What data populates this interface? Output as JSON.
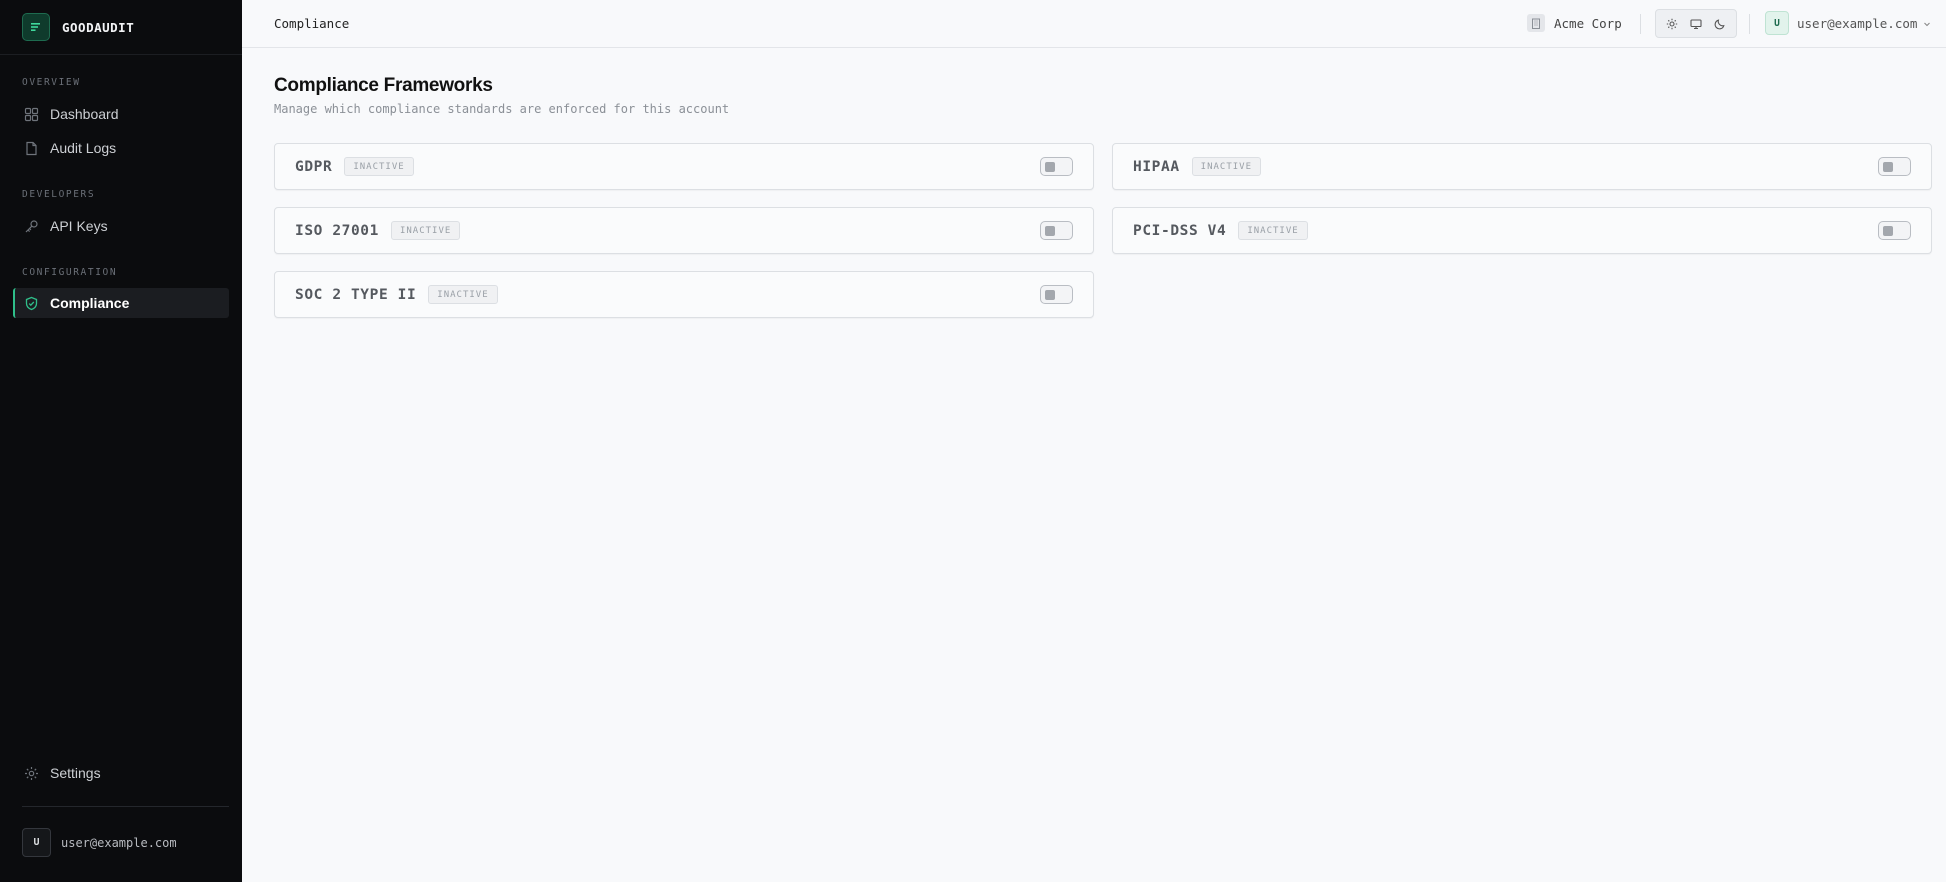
{
  "brand": {
    "name": "GOODAUDIT"
  },
  "sidebar": {
    "sections": [
      {
        "label": "OVERVIEW"
      },
      {
        "label": "DEVELOPERS"
      },
      {
        "label": "CONFIGURATION"
      }
    ],
    "items": [
      {
        "label": "Dashboard",
        "icon": "grid-icon",
        "active": false
      },
      {
        "label": "Audit Logs",
        "icon": "document-icon",
        "active": false
      },
      {
        "label": "API Keys",
        "icon": "key-icon",
        "active": false
      },
      {
        "label": "Compliance",
        "icon": "shield-check-icon",
        "active": true
      },
      {
        "label": "Settings",
        "icon": "gear-icon",
        "active": false
      }
    ],
    "user": {
      "avatar": "U",
      "email": "user@example.com"
    }
  },
  "header": {
    "breadcrumb": "Compliance",
    "org": {
      "name": "Acme Corp",
      "icon": "building-icon"
    },
    "theme_options": [
      "sun-icon",
      "monitor-icon",
      "moon-icon"
    ],
    "user": {
      "avatar": "U",
      "email": "user@example.com"
    }
  },
  "main": {
    "title": "Compliance Frameworks",
    "subtitle": "Manage which compliance standards are enforced for this account",
    "frameworks": [
      {
        "name": "GDPR",
        "status": "INACTIVE",
        "enabled": false
      },
      {
        "name": "HIPAA",
        "status": "INACTIVE",
        "enabled": false
      },
      {
        "name": "ISO 27001",
        "status": "INACTIVE",
        "enabled": false
      },
      {
        "name": "PCI-DSS V4",
        "status": "INACTIVE",
        "enabled": false
      },
      {
        "name": "SOC 2 TYPE II",
        "status": "INACTIVE",
        "enabled": false
      }
    ]
  },
  "colors": {
    "sidebar_bg": "#0b0c0e",
    "accent": "#2fbf8a",
    "page_bg": "#f8f9fb"
  }
}
